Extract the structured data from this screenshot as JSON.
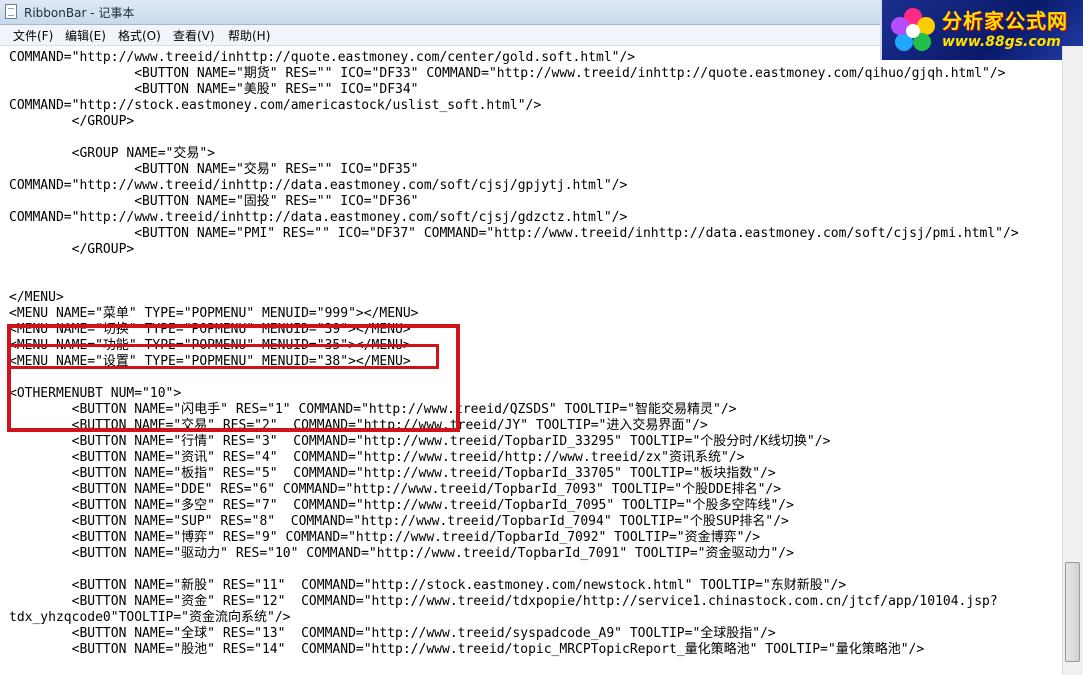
{
  "window": {
    "title": "RibbonBar - 记事本"
  },
  "menubar": {
    "items": [
      "文件(F)",
      "编辑(E)",
      "格式(O)",
      "查看(V)",
      "帮助(H)"
    ]
  },
  "watermark": {
    "text": "分析家公式网",
    "url": "www.88gs.com"
  },
  "editor": {
    "lines": [
      "COMMAND=\"http://www.treeid/inhttp://quote.eastmoney.com/center/gold.soft.html\"/>",
      "                <BUTTON NAME=\"期货\" RES=\"\" ICO=\"DF33\" COMMAND=\"http://www.treeid/inhttp://quote.eastmoney.com/qihuo/gjqh.html\"/>",
      "                <BUTTON NAME=\"美股\" RES=\"\" ICO=\"DF34\"",
      "COMMAND=\"http://stock.eastmoney.com/americastock/uslist_soft.html\"/>",
      "        </GROUP>",
      "",
      "        <GROUP NAME=\"交易\">",
      "                <BUTTON NAME=\"交易\" RES=\"\" ICO=\"DF35\"",
      "COMMAND=\"http://www.treeid/inhttp://data.eastmoney.com/soft/cjsj/gpjytj.html\"/>",
      "                <BUTTON NAME=\"固投\" RES=\"\" ICO=\"DF36\"",
      "COMMAND=\"http://www.treeid/inhttp://data.eastmoney.com/soft/cjsj/gdzctz.html\"/>",
      "                <BUTTON NAME=\"PMI\" RES=\"\" ICO=\"DF37\" COMMAND=\"http://www.treeid/inhttp://data.eastmoney.com/soft/cjsj/pmi.html\"/>",
      "        </GROUP>",
      "",
      "",
      "</MENU>",
      "<MENU NAME=\"菜单\" TYPE=\"POPMENU\" MENUID=\"999\"></MENU>",
      "<MENU NAME=\"切换\" TYPE=\"POPMENU\" MENUID=\"39\"></MENU>",
      "<MENU NAME=\"功能\" TYPE=\"POPMENU\" MENUID=\"35\"></MENU>",
      "<MENU NAME=\"设置\" TYPE=\"POPMENU\" MENUID=\"38\"></MENU>",
      "",
      "<OTHERMENUBT NUM=\"10\">",
      "        <BUTTON NAME=\"闪电手\" RES=\"1\" COMMAND=\"http://www.treeid/QZSDS\" TOOLTIP=\"智能交易精灵\"/>",
      "        <BUTTON NAME=\"交易\" RES=\"2\"  COMMAND=\"http://www.treeid/JY\" TOOLTIP=\"进入交易界面\"/>",
      "        <BUTTON NAME=\"行情\" RES=\"3\"  COMMAND=\"http://www.treeid/TopbarID_33295\" TOOLTIP=\"个股分时/K线切换\"/>",
      "        <BUTTON NAME=\"资讯\" RES=\"4\"  COMMAND=\"http://www.treeid/http://www.treeid/zx\"资讯系统\"/>",
      "        <BUTTON NAME=\"板指\" RES=\"5\"  COMMAND=\"http://www.treeid/TopbarId_33705\" TOOLTIP=\"板块指数\"/>",
      "        <BUTTON NAME=\"DDE\" RES=\"6\" COMMAND=\"http://www.treeid/TopbarId_7093\" TOOLTIP=\"个股DDE排名\"/>",
      "        <BUTTON NAME=\"多空\" RES=\"7\"  COMMAND=\"http://www.treeid/TopbarId_7095\" TOOLTIP=\"个股多空阵线\"/>",
      "        <BUTTON NAME=\"SUP\" RES=\"8\"  COMMAND=\"http://www.treeid/TopbarId_7094\" TOOLTIP=\"个股SUP排名\"/>",
      "        <BUTTON NAME=\"博弈\" RES=\"9\" COMMAND=\"http://www.treeid/TopbarId_7092\" TOOLTIP=\"资金博弈\"/>",
      "        <BUTTON NAME=\"驱动力\" RES=\"10\" COMMAND=\"http://www.treeid/TopbarId_7091\" TOOLTIP=\"资金驱动力\"/>",
      "",
      "        <BUTTON NAME=\"新股\" RES=\"11\"  COMMAND=\"http://stock.eastmoney.com/newstock.html\" TOOLTIP=\"东财新股\"/>",
      "        <BUTTON NAME=\"资金\" RES=\"12\"  COMMAND=\"http://www.treeid/tdxpopie/http://service1.chinastock.com.cn/jtcf/app/10104.jsp?",
      "tdx_yhzqcode0\"TOOLTIP=\"资金流向系统\"/>",
      "        <BUTTON NAME=\"全球\" RES=\"13\"  COMMAND=\"http://www.treeid/syspadcode_A9\" TOOLTIP=\"全球股指\"/>",
      "        <BUTTON NAME=\"股池\" RES=\"14\"  COMMAND=\"http://www.treeid/topic_MRCPTopicReport_量化策略池\" TOOLTIP=\"量化策略池\"/>"
    ]
  },
  "colors": {
    "highlight": "#d0121b",
    "logo_text": "#ffe100"
  }
}
